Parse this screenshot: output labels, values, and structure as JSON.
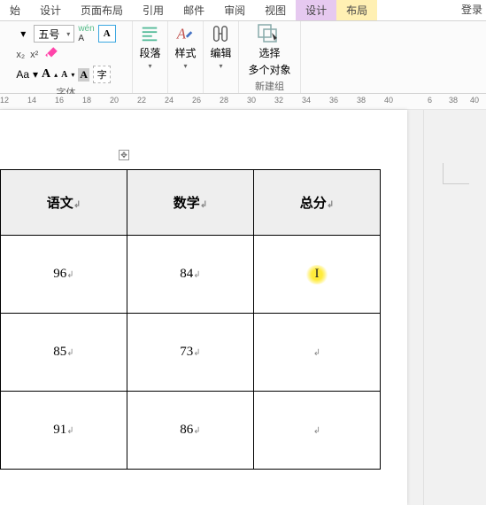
{
  "tabs": {
    "start": "始",
    "design_doc": "设计",
    "layout_page": "页面布局",
    "references": "引用",
    "mailings": "邮件",
    "review": "审阅",
    "view": "视图",
    "design_ctx": "设计",
    "layout_ctx": "布局",
    "login": "登录"
  },
  "font_group": {
    "label": "字体",
    "size": "五号",
    "wen": "wén",
    "a_box": "A",
    "x2": "x₂",
    "x2sup": "x²",
    "aa": "Aa",
    "a_big": "A",
    "a_small": "A",
    "a_hl": "A",
    "char": "字"
  },
  "para_group": {
    "label": "段落"
  },
  "styles_group": {
    "label": "样式"
  },
  "edit_group": {
    "label": "编辑"
  },
  "select_group": {
    "label_line1": "选择",
    "label_line2": "多个对象",
    "group_name": "新建组"
  },
  "ruler_numbers": [
    "12",
    "14",
    "16",
    "18",
    "20",
    "22",
    "24",
    "26",
    "28",
    "30",
    "32",
    "34",
    "36",
    "38",
    "40"
  ],
  "side_ruler_numbers": [
    "6",
    "38",
    "40"
  ],
  "chart_data": {
    "type": "table",
    "columns": [
      "语文",
      "数学",
      "总分"
    ],
    "rows": [
      {
        "lang": "96",
        "math": "84",
        "total": ""
      },
      {
        "lang": "85",
        "math": "73",
        "total": ""
      },
      {
        "lang": "91",
        "math": "86",
        "total": ""
      }
    ]
  }
}
